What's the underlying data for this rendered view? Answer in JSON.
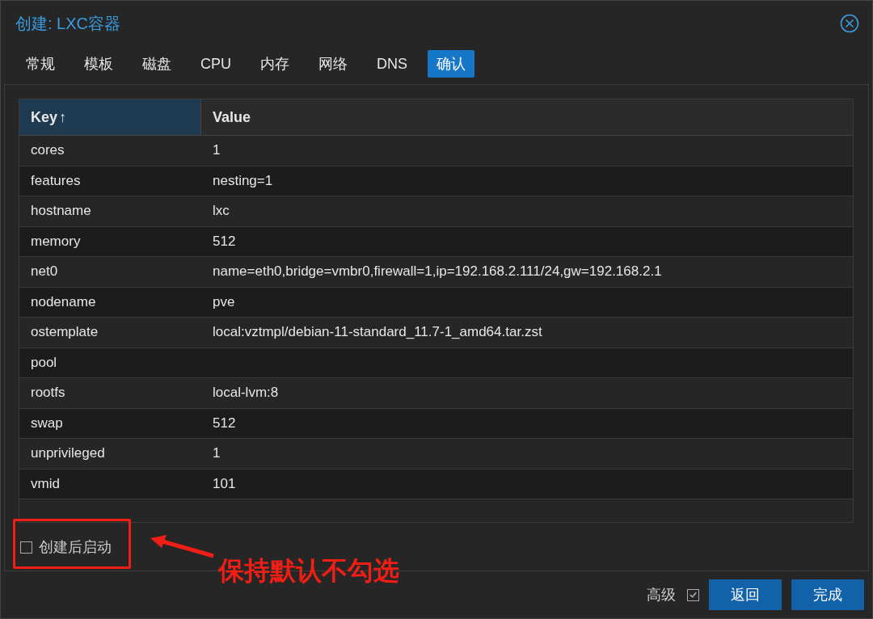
{
  "window": {
    "title": "创建: LXC容器"
  },
  "tabs": [
    {
      "label": "常规",
      "selected": false
    },
    {
      "label": "模板",
      "selected": false
    },
    {
      "label": "磁盘",
      "selected": false
    },
    {
      "label": "CPU",
      "selected": false
    },
    {
      "label": "内存",
      "selected": false
    },
    {
      "label": "网络",
      "selected": false
    },
    {
      "label": "DNS",
      "selected": false
    },
    {
      "label": "确认",
      "selected": true
    }
  ],
  "table": {
    "columns": [
      {
        "label": "Key",
        "sort_icon": "↑"
      },
      {
        "label": "Value"
      }
    ],
    "rows": [
      {
        "key": "cores",
        "value": "1"
      },
      {
        "key": "features",
        "value": "nesting=1"
      },
      {
        "key": "hostname",
        "value": "lxc"
      },
      {
        "key": "memory",
        "value": "512"
      },
      {
        "key": "net0",
        "value": "name=eth0,bridge=vmbr0,firewall=1,ip=192.168.2.111/24,gw=192.168.2.1"
      },
      {
        "key": "nodename",
        "value": "pve"
      },
      {
        "key": "ostemplate",
        "value": "local:vztmpl/debian-11-standard_11.7-1_amd64.tar.zst"
      },
      {
        "key": "pool",
        "value": ""
      },
      {
        "key": "rootfs",
        "value": "local-lvm:8"
      },
      {
        "key": "swap",
        "value": "512"
      },
      {
        "key": "unprivileged",
        "value": "1"
      },
      {
        "key": "vmid",
        "value": "101"
      }
    ]
  },
  "start_after_create": {
    "label": "创建后启动",
    "checked": false
  },
  "annotation": {
    "text": "保持默认不勾选"
  },
  "footer": {
    "advanced": {
      "label": "高级",
      "checked": true
    },
    "buttons": [
      "返回",
      "完成"
    ]
  }
}
